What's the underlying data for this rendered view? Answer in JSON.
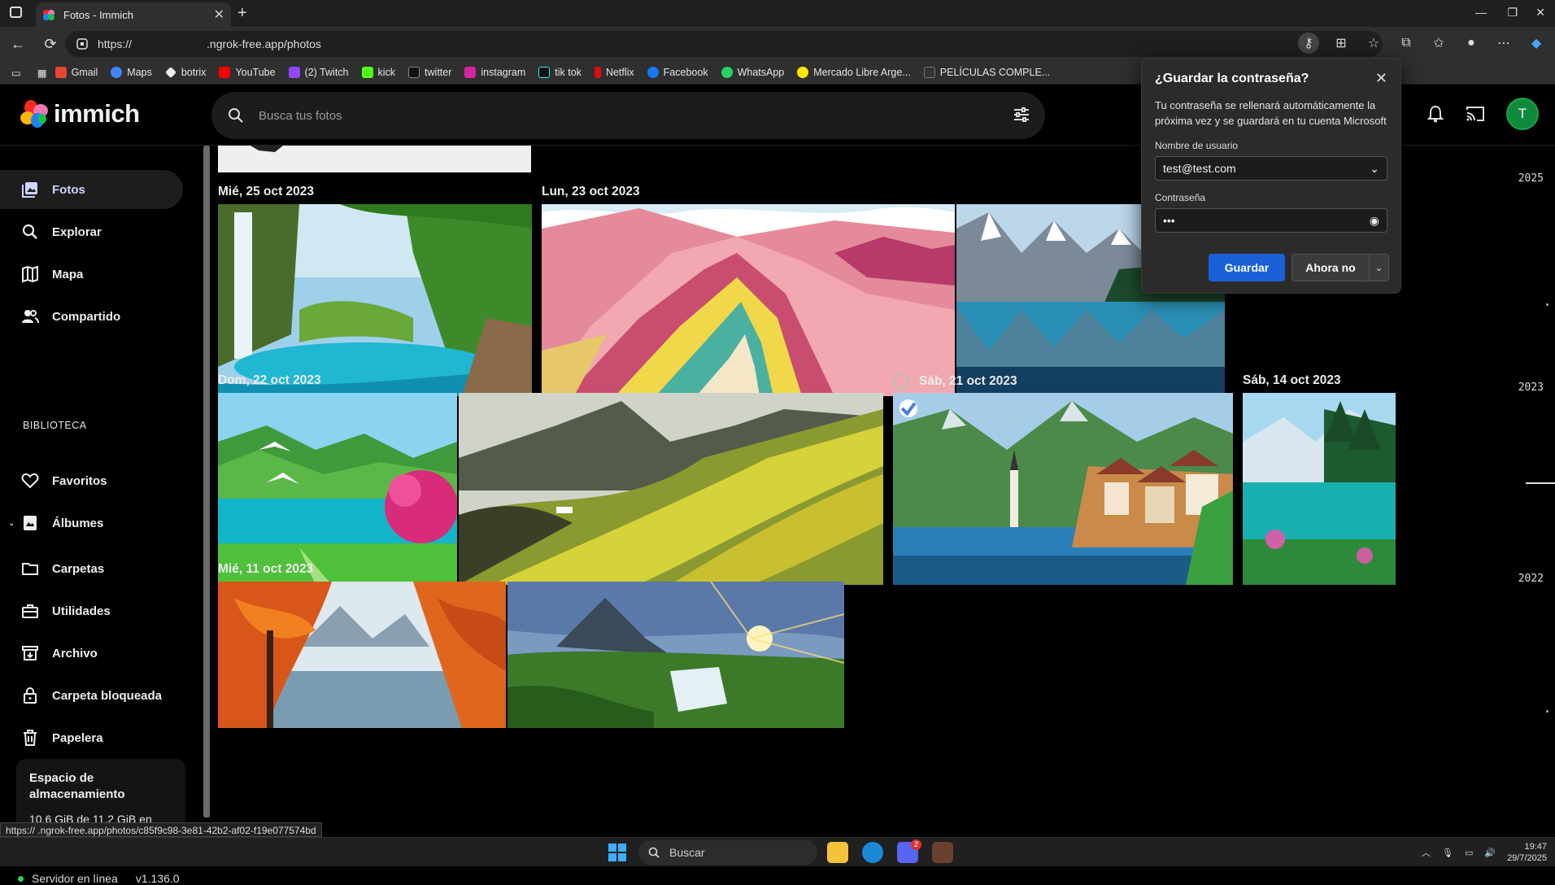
{
  "browser": {
    "tab_title": "Fotos - Immich",
    "url_scheme": "https://",
    "url_host": ".ngrok-free.app",
    "url_path": "/photos",
    "favorites": [
      {
        "label": "Gmail",
        "icon": "gmail-icon",
        "color": "#ea4335"
      },
      {
        "label": "Maps",
        "icon": "google-icon",
        "color": "#4285f4"
      },
      {
        "label": "botrix",
        "icon": "botrix-icon",
        "color": "#eeeeee"
      },
      {
        "label": "YouTube",
        "icon": "youtube-icon",
        "color": "#ff0000"
      },
      {
        "label": "(2) Twitch",
        "icon": "twitch-icon",
        "color": "#9146ff"
      },
      {
        "label": "kick",
        "icon": "kick-icon",
        "color": "#53fc18"
      },
      {
        "label": "twitter",
        "icon": "x-icon",
        "color": "#111111"
      },
      {
        "label": "instagram",
        "icon": "instagram-icon",
        "color": "#d6249f"
      },
      {
        "label": "tik tok",
        "icon": "tiktok-icon",
        "color": "#111111"
      },
      {
        "label": "Netflix",
        "icon": "netflix-icon",
        "color": "#e50914"
      },
      {
        "label": "Facebook",
        "icon": "facebook-icon",
        "color": "#1877f2"
      },
      {
        "label": "WhatsApp",
        "icon": "whatsapp-icon",
        "color": "#25d366"
      },
      {
        "label": "Mercado Libre Arge...",
        "icon": "mercadolibre-icon",
        "color": "#ffe600"
      },
      {
        "label": "PELÍCULAS COMPLE...",
        "icon": "film-icon",
        "color": "#333333"
      }
    ],
    "status_url": "https://                    .ngrok-free.app/photos/c85f9c98-3e81-42b2-af02-f19e077574bd"
  },
  "app": {
    "logo_text": "immich",
    "search_placeholder": "Busca tus fotos",
    "avatar_letter": "T",
    "nav": [
      {
        "label": "Fotos",
        "icon": "photos-icon",
        "active": true
      },
      {
        "label": "Explorar",
        "icon": "search-icon",
        "active": false
      },
      {
        "label": "Mapa",
        "icon": "map-icon",
        "active": false
      },
      {
        "label": "Compartido",
        "icon": "people-icon",
        "active": false
      }
    ],
    "library_label": "BIBLIOTECA",
    "library": [
      {
        "label": "Favoritos",
        "icon": "heart-icon"
      },
      {
        "label": "Álbumes",
        "icon": "album-icon"
      },
      {
        "label": "Carpetas",
        "icon": "folder-icon"
      },
      {
        "label": "Utilidades",
        "icon": "toolbox-icon"
      },
      {
        "label": "Archivo",
        "icon": "archive-icon"
      },
      {
        "label": "Carpeta bloqueada",
        "icon": "lock-icon"
      },
      {
        "label": "Papelera",
        "icon": "trash-icon"
      }
    ],
    "storage": {
      "title": "Espacio de almacenamiento",
      "usage": "10,6 GiB de 11,2 GiB en uso",
      "used_fraction": 0.946
    },
    "server_status": "Servidor en línea",
    "version": "v1.136.0",
    "dates": [
      {
        "label": "Mié, 25 oct 2023"
      },
      {
        "label": "Lun, 23 oct 2023"
      },
      {
        "label": "Dom, 22 oct 2023"
      },
      {
        "label": "Sáb, 21 oct 2023"
      },
      {
        "label": "Sáb, 14 oct 2023"
      },
      {
        "label": "Mié, 11 oct 2023"
      }
    ],
    "years": [
      "2025",
      "2023",
      "2022"
    ]
  },
  "password_popup": {
    "title": "¿Guardar la contraseña?",
    "description": "Tu contraseña se rellenará automáticamente la próxima vez y se guardará en tu cuenta Microsoft",
    "username_label": "Nombre de usuario",
    "username_value": "test@test.com",
    "password_label": "Contraseña",
    "password_value": "•••",
    "save_label": "Guardar",
    "not_now_label": "Ahora no"
  },
  "taskbar": {
    "search_label": "Buscar",
    "time": "19:47",
    "date": "29/7/2025",
    "discord_badge": "2"
  }
}
